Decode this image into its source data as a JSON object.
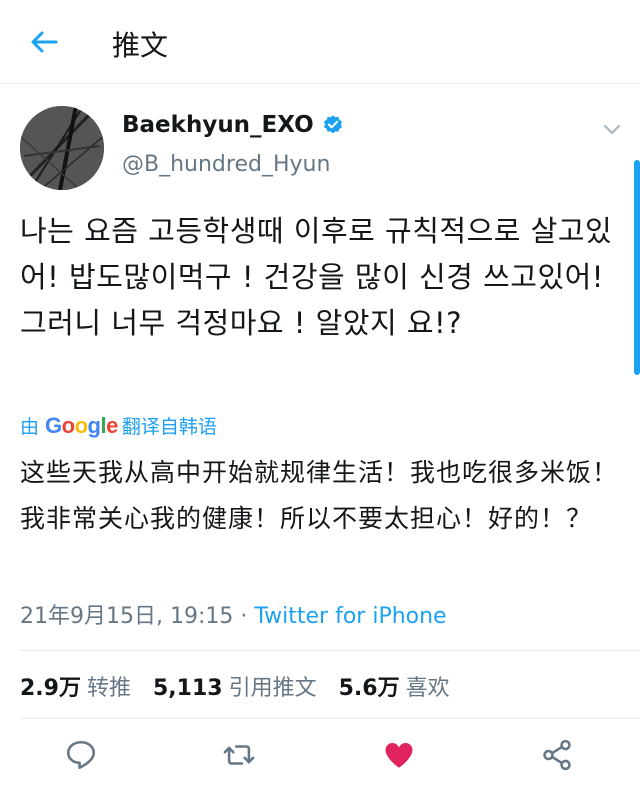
{
  "header": {
    "title": "推文"
  },
  "user": {
    "display_name": "Baekhyun_EXO",
    "handle": "@B_hundred_Hyun",
    "verified": true
  },
  "tweet": {
    "text": "나는 요즘 고등학생때 이후로 규칙적으로 살고있어! 밥도많이먹구 ! 건강을 많이 신경 쓰고있어! 그러니 너무 걱정마요 ! 알았지 요!?",
    "translation_prefix": "由",
    "translation_brand": "Google",
    "translation_suffix": "翻译自韩语",
    "translated_text": "这些天我从高中开始就规律生活！我也吃很多米饭！我非常关心我的健康！所以不要太担心！好的！？",
    "timestamp": "21年9月15日, 19:15",
    "separator": " · ",
    "source": "Twitter for iPhone"
  },
  "stats": {
    "retweets_count": "2.9万",
    "retweets_label": "转推",
    "quotes_count": "5,113",
    "quotes_label": "引用推文",
    "likes_count": "5.6万",
    "likes_label": "喜欢"
  },
  "colors": {
    "accent": "#1da1f2",
    "secondary_text": "#657786",
    "like": "#e0245e"
  },
  "icons": {
    "back": "arrow-left-icon",
    "verified": "verified-badge-icon",
    "caret": "chevron-down-icon",
    "reply": "reply-icon",
    "retweet": "retweet-icon",
    "like": "heart-icon",
    "share": "share-icon"
  }
}
